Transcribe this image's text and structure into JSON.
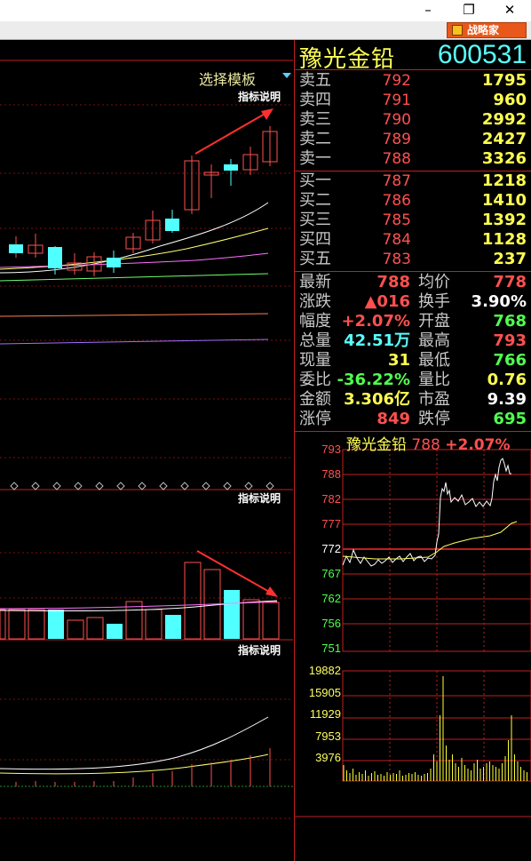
{
  "window": {
    "minimize_glyph": "–",
    "restore_glyph": "❐",
    "close_glyph": "✕",
    "zlj_label": "战略家"
  },
  "left": {
    "template_label": "选择模板",
    "indicator_note": "指标说明"
  },
  "stock": {
    "name": "豫光金铅",
    "code": "600531"
  },
  "order_book": {
    "sell": [
      {
        "label": "卖五",
        "price": "792",
        "volume": "1795"
      },
      {
        "label": "卖四",
        "price": "791",
        "volume": "960"
      },
      {
        "label": "卖三",
        "price": "790",
        "volume": "2992"
      },
      {
        "label": "卖二",
        "price": "789",
        "volume": "2427"
      },
      {
        "label": "卖一",
        "price": "788",
        "volume": "3326"
      }
    ],
    "buy": [
      {
        "label": "买一",
        "price": "787",
        "volume": "1218"
      },
      {
        "label": "买二",
        "price": "786",
        "volume": "1410"
      },
      {
        "label": "买三",
        "price": "785",
        "volume": "1392"
      },
      {
        "label": "买四",
        "price": "784",
        "volume": "1128"
      },
      {
        "label": "买五",
        "price": "783",
        "volume": "237"
      }
    ]
  },
  "quote": [
    {
      "l1": "最新",
      "v1": "788",
      "c1": "#ff5050",
      "l2": "均价",
      "v2": "778",
      "c2": "#ff5050"
    },
    {
      "l1": "涨跌",
      "v1": "▲016",
      "c1": "#ff5050",
      "l2": "换手",
      "v2": "3.90%",
      "c2": "#ffffff"
    },
    {
      "l1": "幅度",
      "v1": "+2.07%",
      "c1": "#ff5050",
      "l2": "开盘",
      "v2": "768",
      "c2": "#50ff50"
    },
    {
      "l1": "总量",
      "v1": "42.51万",
      "c1": "#58ffff",
      "l2": "最高",
      "v2": "793",
      "c2": "#ff5050"
    },
    {
      "l1": "现量",
      "v1": "31",
      "c1": "#ffff50",
      "l2": "最低",
      "v2": "766",
      "c2": "#50ff50"
    },
    {
      "l1": "委比",
      "v1": "-36.22%",
      "c1": "#50ff50",
      "l2": "量比",
      "v2": "0.76",
      "c2": "#ffff50"
    },
    {
      "l1": "金额",
      "v1": "3.306亿",
      "c1": "#ffff50",
      "l2": "市盈",
      "v2": "9.39",
      "c2": "#ffffff"
    },
    {
      "l1": "涨停",
      "v1": "849",
      "c1": "#ff5050",
      "l2": "跌停",
      "v2": "695",
      "c2": "#50ff50"
    }
  ],
  "intraday": {
    "title_name": "豫光金铅",
    "title_price": "788",
    "title_change": "+2.07%",
    "price_labels": [
      {
        "text": "793",
        "color": "#ff5050"
      },
      {
        "text": "788",
        "color": "#ff5050"
      },
      {
        "text": "782",
        "color": "#ff5050"
      },
      {
        "text": "777",
        "color": "#ff5050"
      },
      {
        "text": "772",
        "color": "#ffffff"
      },
      {
        "text": "767",
        "color": "#50ff50"
      },
      {
        "text": "762",
        "color": "#50ff50"
      },
      {
        "text": "756",
        "color": "#50ff50"
      },
      {
        "text": "751",
        "color": "#50ff50"
      }
    ],
    "volume_labels": [
      "19882",
      "15905",
      "11929",
      "7953",
      "3976"
    ]
  },
  "colors": {
    "up": "#ff5050",
    "down": "#50ffff",
    "grid": "#c02020"
  }
}
